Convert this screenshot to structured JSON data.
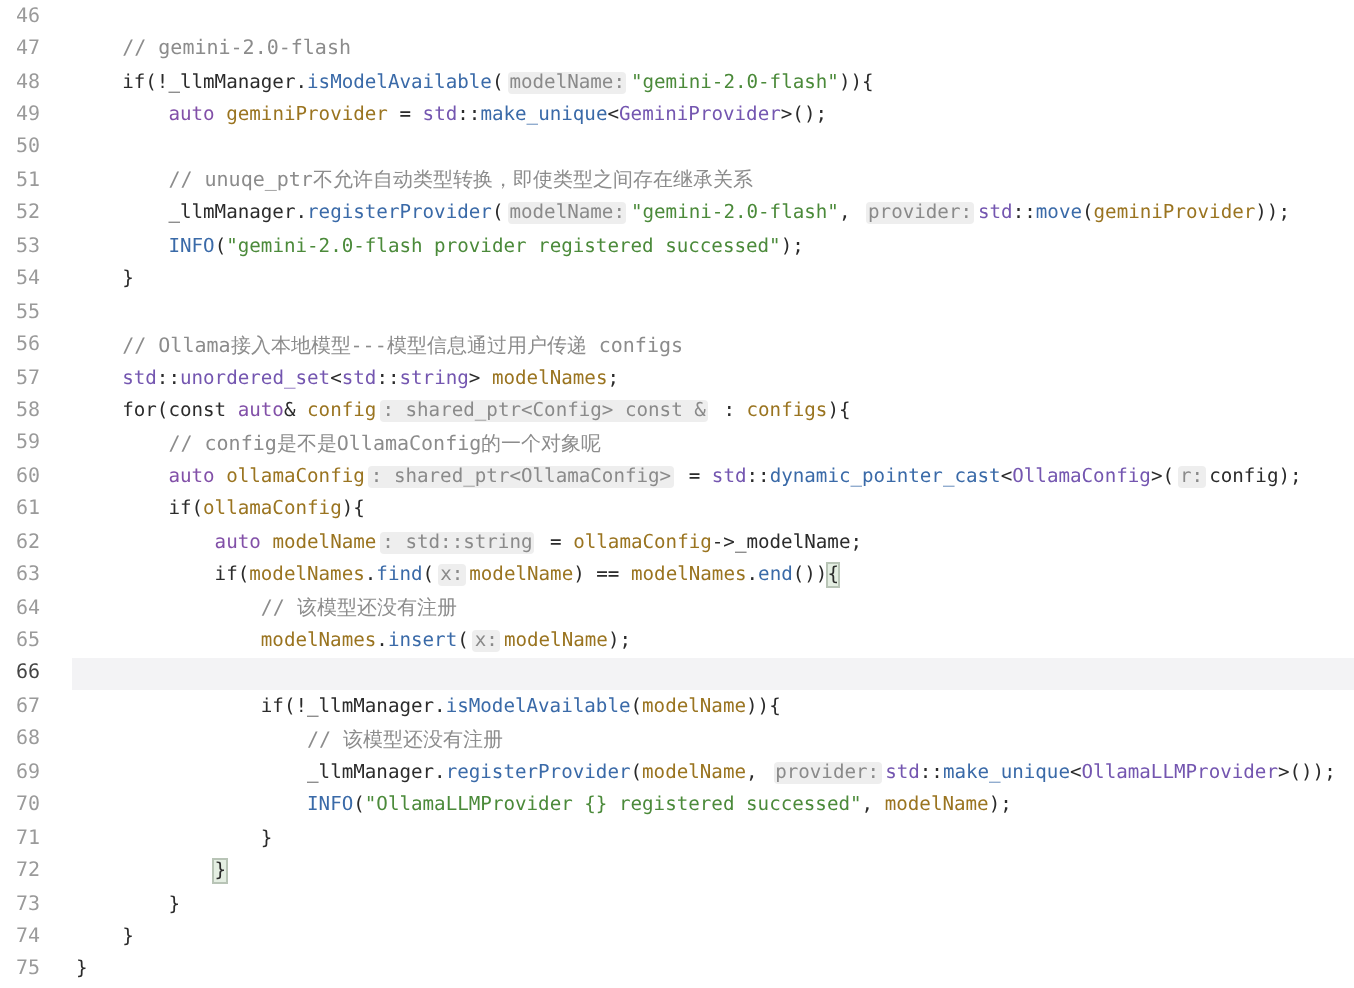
{
  "editor": {
    "lines": [
      {
        "number": "46",
        "current": false
      },
      {
        "number": "47",
        "current": false,
        "tokens": [
          {
            "kind": "comment",
            "text": "// gemini-2.0-flash"
          }
        ]
      },
      {
        "number": "48",
        "current": false,
        "tokens": [
          {
            "kind": "plain",
            "text": "if(!_llmManager."
          },
          {
            "kind": "function",
            "text": "isModelAvailable"
          },
          {
            "kind": "plain",
            "text": "("
          },
          {
            "kind": "hint",
            "text": "modelName:"
          },
          {
            "kind": "string",
            "text": "\"gemini-2.0-flash\""
          },
          {
            "kind": "plain",
            "text": ")){"
          }
        ],
        "children": [
          {
            "number": "49",
            "current": false,
            "tokens": [
              {
                "kind": "keyword",
                "text": "auto "
              },
              {
                "kind": "variable",
                "text": "geminiProvider"
              },
              {
                "kind": "plain",
                "text": " = "
              },
              {
                "kind": "type",
                "text": "std"
              },
              {
                "kind": "plain",
                "text": "::"
              },
              {
                "kind": "function",
                "text": "make_unique"
              },
              {
                "kind": "plain",
                "text": "<"
              },
              {
                "kind": "type",
                "text": "GeminiProvider"
              },
              {
                "kind": "plain",
                "text": ">();"
              }
            ]
          },
          {
            "number": "50",
            "current": false
          },
          {
            "number": "51",
            "current": false,
            "tokens": [
              {
                "kind": "comment",
                "text": "// unuqe_ptr不允许自动类型转换，即使类型之间存在继承关系"
              }
            ]
          },
          {
            "number": "52",
            "current": false,
            "tokens": [
              {
                "kind": "plain",
                "text": "_llmManager."
              },
              {
                "kind": "function",
                "text": "registerProvider"
              },
              {
                "kind": "plain",
                "text": "("
              },
              {
                "kind": "hint",
                "text": "modelName:"
              },
              {
                "kind": "string",
                "text": "\"gemini-2.0-flash\""
              },
              {
                "kind": "plain",
                "text": ", "
              },
              {
                "kind": "hint",
                "text": "provider:"
              },
              {
                "kind": "type",
                "text": "std"
              },
              {
                "kind": "plain",
                "text": "::"
              },
              {
                "kind": "function",
                "text": "move"
              },
              {
                "kind": "plain",
                "text": "("
              },
              {
                "kind": "variable",
                "text": "geminiProvider"
              },
              {
                "kind": "plain",
                "text": "));"
              }
            ]
          },
          {
            "number": "53",
            "current": false,
            "tokens": [
              {
                "kind": "function",
                "text": "INFO"
              },
              {
                "kind": "plain",
                "text": "("
              },
              {
                "kind": "string",
                "text": "\"gemini-2.0-flash provider registered successed\""
              },
              {
                "kind": "plain",
                "text": ");"
              }
            ]
          }
        ]
      },
      {
        "number": "54",
        "current": false,
        "tokens": [
          {
            "kind": "plain",
            "text": "}"
          }
        ]
      },
      {
        "number": "55",
        "current": false
      },
      {
        "number": "56",
        "current": false,
        "tokens": [
          {
            "kind": "comment",
            "text": "// Ollama接入本地模型---模型信息通过用户传递 configs"
          }
        ]
      },
      {
        "number": "57",
        "current": false,
        "tokens": [
          {
            "kind": "type",
            "text": "std"
          },
          {
            "kind": "plain",
            "text": "::"
          },
          {
            "kind": "type",
            "text": "unordered_set"
          },
          {
            "kind": "plain",
            "text": "<"
          },
          {
            "kind": "type",
            "text": "std"
          },
          {
            "kind": "plain",
            "text": "::"
          },
          {
            "kind": "type",
            "text": "string"
          },
          {
            "kind": "plain",
            "text": "> "
          },
          {
            "kind": "variable",
            "text": "modelNames"
          },
          {
            "kind": "plain",
            "text": ";"
          }
        ]
      },
      {
        "number": "58",
        "current": false,
        "tokens": [
          {
            "kind": "plain",
            "text": "for(const "
          },
          {
            "kind": "keyword",
            "text": "auto"
          },
          {
            "kind": "plain",
            "text": "& "
          },
          {
            "kind": "variable",
            "text": "config"
          },
          {
            "kind": "hint",
            "text": ": shared_ptr<Config> const &"
          },
          {
            "kind": "plain",
            "text": " : "
          },
          {
            "kind": "variable",
            "text": "configs"
          },
          {
            "kind": "plain",
            "text": "){"
          }
        ],
        "children": [
          {
            "number": "59",
            "current": false,
            "tokens": [
              {
                "kind": "comment",
                "text": "// config是不是OllamaConfig的一个对象呢"
              }
            ]
          },
          {
            "number": "60",
            "current": false,
            "tokens": [
              {
                "kind": "keyword",
                "text": "auto "
              },
              {
                "kind": "variable",
                "text": "ollamaConfig"
              },
              {
                "kind": "hint",
                "text": ": shared_ptr<OllamaConfig>"
              },
              {
                "kind": "plain",
                "text": " = "
              },
              {
                "kind": "type",
                "text": "std"
              },
              {
                "kind": "plain",
                "text": "::"
              },
              {
                "kind": "function",
                "text": "dynamic_pointer_cast"
              },
              {
                "kind": "plain",
                "text": "<"
              },
              {
                "kind": "type",
                "text": "OllamaConfig"
              },
              {
                "kind": "plain",
                "text": ">("
              },
              {
                "kind": "hint",
                "text": "r:"
              },
              {
                "kind": "plain",
                "text": "config);"
              }
            ]
          },
          {
            "number": "61",
            "current": false,
            "tokens": [
              {
                "kind": "plain",
                "text": "if("
              },
              {
                "kind": "variable",
                "text": "ollamaConfig"
              },
              {
                "kind": "plain",
                "text": "){"
              }
            ],
            "children": [
              {
                "number": "62",
                "current": false,
                "tokens": [
                  {
                    "kind": "keyword",
                    "text": "auto "
                  },
                  {
                    "kind": "variable",
                    "text": "modelName"
                  },
                  {
                    "kind": "hint",
                    "text": ": std::string"
                  },
                  {
                    "kind": "plain",
                    "text": " = "
                  },
                  {
                    "kind": "variable",
                    "text": "ollamaConfig"
                  },
                  {
                    "kind": "plain",
                    "text": "->_modelName;"
                  }
                ]
              },
              {
                "number": "63",
                "current": false,
                "tokens": [
                  {
                    "kind": "plain",
                    "text": "if("
                  },
                  {
                    "kind": "variable",
                    "text": "modelNames"
                  },
                  {
                    "kind": "plain",
                    "text": "."
                  },
                  {
                    "kind": "function",
                    "text": "find"
                  },
                  {
                    "kind": "plain",
                    "text": "("
                  },
                  {
                    "kind": "hint",
                    "text": "x:"
                  },
                  {
                    "kind": "variable",
                    "text": "modelName"
                  },
                  {
                    "kind": "plain",
                    "text": ") == "
                  },
                  {
                    "kind": "variable",
                    "text": "modelNames"
                  },
                  {
                    "kind": "plain",
                    "text": "."
                  },
                  {
                    "kind": "function",
                    "text": "end"
                  },
                  {
                    "kind": "plain",
                    "text": "())"
                  },
                  {
                    "kind": "matched_brace",
                    "text": "{"
                  }
                ],
                "children": [
                  {
                    "number": "64",
                    "current": false,
                    "tokens": [
                      {
                        "kind": "comment",
                        "text": "// 该模型还没有注册"
                      }
                    ]
                  },
                  {
                    "number": "65",
                    "current": false,
                    "tokens": [
                      {
                        "kind": "variable",
                        "text": "modelNames"
                      },
                      {
                        "kind": "plain",
                        "text": "."
                      },
                      {
                        "kind": "function",
                        "text": "insert"
                      },
                      {
                        "kind": "plain",
                        "text": "("
                      },
                      {
                        "kind": "hint",
                        "text": "x:"
                      },
                      {
                        "kind": "variable",
                        "text": "modelName"
                      },
                      {
                        "kind": "plain",
                        "text": ");"
                      }
                    ]
                  },
                  {
                    "number": "66",
                    "current": true
                  },
                  {
                    "number": "67",
                    "current": false,
                    "tokens": [
                      {
                        "kind": "plain",
                        "text": "if(!_llmManager."
                      },
                      {
                        "kind": "function",
                        "text": "isModelAvailable"
                      },
                      {
                        "kind": "plain",
                        "text": "("
                      },
                      {
                        "kind": "variable",
                        "text": "modelName"
                      },
                      {
                        "kind": "plain",
                        "text": ")){"
                      }
                    ],
                    "children": [
                      {
                        "number": "68",
                        "current": false,
                        "tokens": [
                          {
                            "kind": "comment",
                            "text": "// 该模型还没有注册"
                          }
                        ]
                      },
                      {
                        "number": "69",
                        "current": false,
                        "tokens": [
                          {
                            "kind": "plain",
                            "text": "_llmManager."
                          },
                          {
                            "kind": "function",
                            "text": "registerProvider"
                          },
                          {
                            "kind": "plain",
                            "text": "("
                          },
                          {
                            "kind": "variable",
                            "text": "modelName"
                          },
                          {
                            "kind": "plain",
                            "text": ", "
                          },
                          {
                            "kind": "hint",
                            "text": "provider:"
                          },
                          {
                            "kind": "type",
                            "text": "std"
                          },
                          {
                            "kind": "plain",
                            "text": "::"
                          },
                          {
                            "kind": "function",
                            "text": "make_unique"
                          },
                          {
                            "kind": "plain",
                            "text": "<"
                          },
                          {
                            "kind": "type",
                            "text": "OllamaLLMProvider"
                          },
                          {
                            "kind": "plain",
                            "text": ">());"
                          }
                        ]
                      },
                      {
                        "number": "70",
                        "current": false,
                        "tokens": [
                          {
                            "kind": "function",
                            "text": "INFO"
                          },
                          {
                            "kind": "plain",
                            "text": "("
                          },
                          {
                            "kind": "string",
                            "text": "\"OllamaLLMProvider {} registered successed\""
                          },
                          {
                            "kind": "plain",
                            "text": ", "
                          },
                          {
                            "kind": "variable",
                            "text": "modelName"
                          },
                          {
                            "kind": "plain",
                            "text": ");"
                          }
                        ]
                      }
                    ]
                  },
                  {
                    "number": "71",
                    "current": false,
                    "tokens": [
                      {
                        "kind": "plain",
                        "text": "}"
                      }
                    ]
                  }
                ]
              },
              {
                "number": "72",
                "current": false,
                "tokens": [
                  {
                    "kind": "matched_brace",
                    "text": "}"
                  }
                ]
              }
            ]
          },
          {
            "number": "73",
            "current": false,
            "tokens": [
              {
                "kind": "plain",
                "text": "}"
              }
            ]
          }
        ]
      },
      {
        "number": "74",
        "current": false,
        "tokens": [
          {
            "kind": "plain",
            "text": "}"
          }
        ]
      }
    ],
    "trailing_lines": [
      {
        "number": "75",
        "current": false,
        "tokens": [
          {
            "kind": "plain",
            "text": "}"
          }
        ]
      }
    ]
  }
}
